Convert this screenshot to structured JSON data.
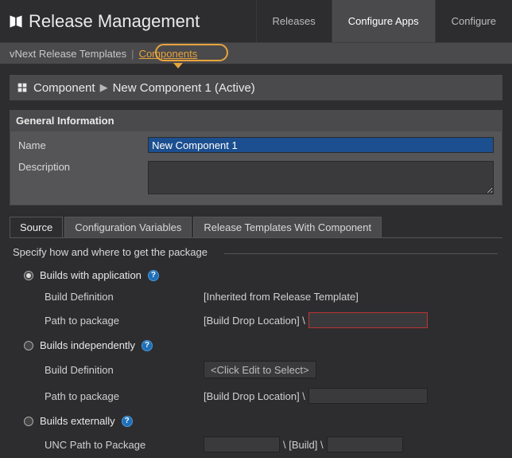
{
  "app": {
    "title": "Release Management"
  },
  "primaryTabs": {
    "releases": "Releases",
    "configureApps": "Configure Apps",
    "configure": "Configure"
  },
  "subnav": {
    "templates": "vNext Release Templates",
    "components": "Components"
  },
  "breadcrumb": {
    "root": "Component",
    "current": "New Component 1 (Active)"
  },
  "section": {
    "general": "General Information"
  },
  "form": {
    "nameLabel": "Name",
    "nameValue": "New Component 1",
    "descLabel": "Description"
  },
  "tabs": {
    "source": "Source",
    "configVars": "Configuration Variables",
    "relTemplates": "Release Templates With Component"
  },
  "sourceSection": {
    "legend": "Specify how and where to get the package",
    "option1": {
      "label": "Builds with application",
      "buildDefLabel": "Build Definition",
      "buildDefValue": "[Inherited from Release Template]",
      "pathLabel": "Path to package",
      "pathPrefix": "[Build Drop Location] \\"
    },
    "option2": {
      "label": "Builds independently",
      "buildDefLabel": "Build Definition",
      "selectPlaceholder": "<Click Edit to Select>",
      "pathLabel": "Path to package",
      "pathPrefix": "[Build Drop Location] \\"
    },
    "option3": {
      "label": "Builds externally",
      "uncLabel": "UNC Path to Package",
      "buildToken": "\\ [Build] \\"
    }
  }
}
